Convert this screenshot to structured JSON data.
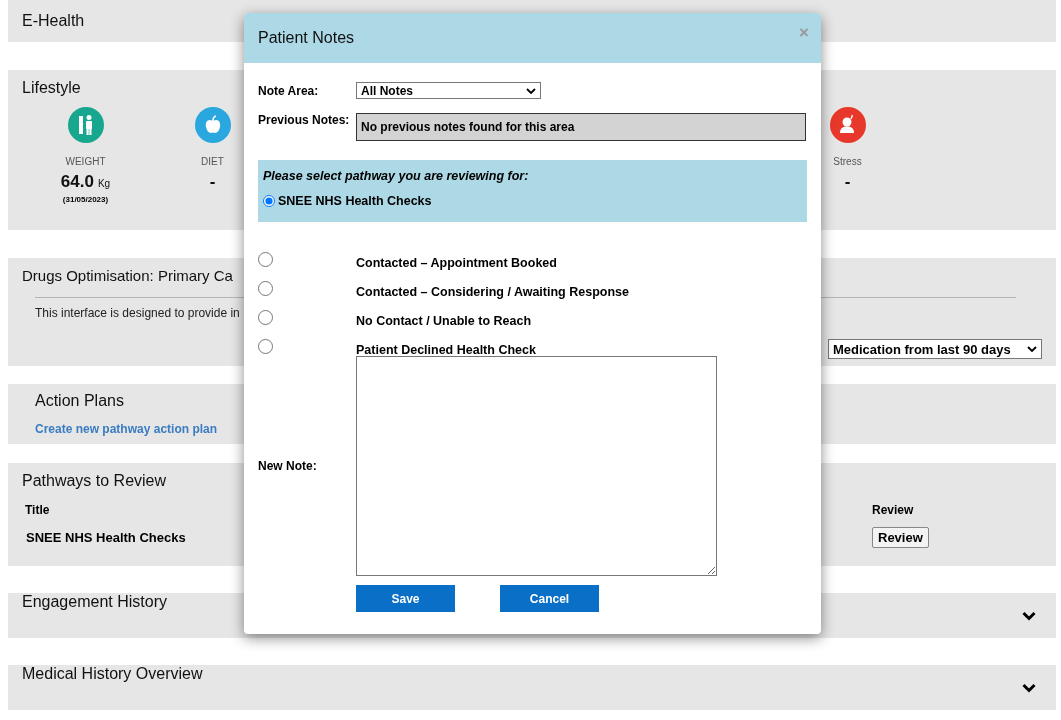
{
  "e_health": {
    "title": "E-Health"
  },
  "lifestyle": {
    "title": "Lifestyle",
    "metrics": [
      {
        "kind": "weight",
        "label": "WEIGHT",
        "value": "64.0",
        "unit": "Kg",
        "date": "(31/05/2023)"
      },
      {
        "kind": "diet",
        "label": "DIET",
        "value": "-"
      },
      {
        "kind": "stress",
        "label": "Stress",
        "value": "-"
      }
    ]
  },
  "drugs_optimisation": {
    "title": "Drugs Optimisation: Primary Ca",
    "description": "This interface is designed to provide in",
    "filter": "Medication from last 90 days"
  },
  "action_plans": {
    "title": "Action Plans",
    "link": "Create new pathway action plan"
  },
  "pathways_to_review": {
    "title": "Pathways to Review",
    "columns": [
      "Title",
      "Review"
    ],
    "rows": [
      {
        "title": "SNEE NHS Health Checks",
        "button": "Review"
      }
    ]
  },
  "collapsible_sections": [
    {
      "title": "Engagement History",
      "expanded": false
    },
    {
      "title": "Medical History Overview",
      "expanded": false
    }
  ],
  "dialog": {
    "title": "Patient Notes",
    "close": "×",
    "note_area": {
      "label": "Note Area:",
      "value": "All Notes"
    },
    "previous_notes": {
      "label": "Previous Notes:",
      "value": "No previous notes found for this area"
    },
    "pathway_prompt": "Please select pathway you are reviewing for:",
    "pathways": [
      {
        "label": "SNEE NHS Health Checks",
        "selected": true
      }
    ],
    "outcomes": [
      {
        "label": "Contacted – Appointment Booked",
        "selected": false
      },
      {
        "label": "Contacted – Considering / Awaiting Response",
        "selected": false
      },
      {
        "label": "No Contact / Unable to Reach",
        "selected": false
      },
      {
        "label": "Patient Declined Health Check",
        "selected": false
      }
    ],
    "new_note": {
      "label": "New Note:"
    },
    "buttons": [
      "Save",
      "Cancel"
    ]
  }
}
